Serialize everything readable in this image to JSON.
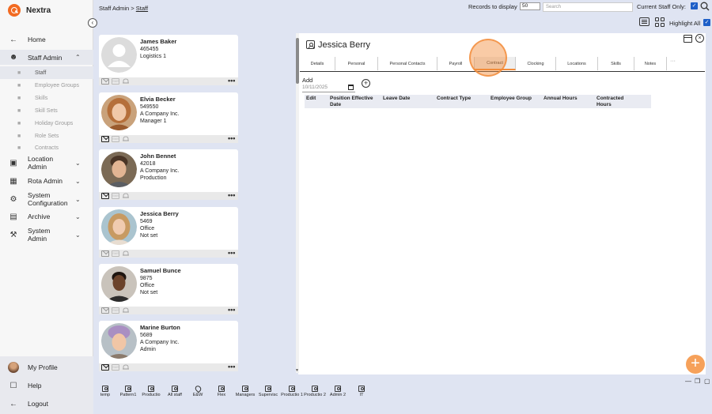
{
  "app": {
    "name": "Nextra"
  },
  "sidebar": {
    "collapse_icon": "chevron-left-icon",
    "items": [
      {
        "label": "Home",
        "icon": "arrow-left-icon"
      },
      {
        "label": "Staff Admin",
        "icon": "staff-icon"
      },
      {
        "label": "Location Admin",
        "icon": "location-icon"
      },
      {
        "label": "Rota Admin",
        "icon": "calendar-icon"
      },
      {
        "label": "System Configuration",
        "icon": "gear-icon"
      },
      {
        "label": "Archive",
        "icon": "archive-icon"
      },
      {
        "label": "System Admin",
        "icon": "wrench-icon"
      }
    ],
    "sub_items": [
      "Staff",
      "Employee Groups",
      "Skills",
      "Skill Sets",
      "Holiday Groups",
      "Role Sets",
      "Contracts"
    ],
    "bottom": [
      {
        "label": "My Profile"
      },
      {
        "label": "Help"
      },
      {
        "label": "Logout"
      }
    ]
  },
  "header": {
    "breadcrumb_root": "Staff Admin",
    "breadcrumb_sep": ">",
    "breadcrumb_current": "Staff",
    "records_label": "Records to display",
    "records_value": "50",
    "search_placeholder": "Search",
    "current_staff_label": "Current Staff Only:",
    "highlight_label": "Highlight All"
  },
  "staff": [
    {
      "name": "James Baker",
      "id": "465455",
      "line2": "Logistics 1",
      "line3": ""
    },
    {
      "name": "Elvia Becker",
      "id": "549550",
      "line2": "A Company Inc.",
      "line3": "Manager 1"
    },
    {
      "name": "John Bennet",
      "id": "42018",
      "line2": "A Company Inc.",
      "line3": "Production"
    },
    {
      "name": "Jessica Berry",
      "id": "5469",
      "line2": "Office",
      "line3": "Not set"
    },
    {
      "name": "Samuel Bunce",
      "id": "9875",
      "line2": "Office",
      "line3": "Not set"
    },
    {
      "name": "Marine Burton",
      "id": "5689",
      "line2": "A Company Inc.",
      "line3": "Admin"
    }
  ],
  "card_more_label": "•••",
  "panel": {
    "title": "Jessica Berry",
    "tabs": [
      "Details",
      "Personal",
      "Personal Contacts",
      "Payroll",
      "Contract",
      "Clocking",
      "Locations",
      "Skills",
      "Notes"
    ],
    "active_tab": "Contract",
    "more_label": "···",
    "add_label": "Add",
    "date_value": "10/11/2025",
    "columns": [
      "Edit",
      "Position Effective Date",
      "Leave Date",
      "Contract Type",
      "Employee Group",
      "Annual Hours",
      "Contracted Hours"
    ]
  },
  "bottom_tabs": [
    "temp",
    "Pattern1",
    "Productio",
    "All staff",
    "E&W",
    "Flex",
    "Managers",
    "Supervisc",
    "Productio 1",
    "Productio 2",
    "Admin 2",
    "IT"
  ],
  "colors": {
    "accent": "#f28c3a",
    "checkbox": "#1e5fc8",
    "background": "#dfe4f2"
  }
}
